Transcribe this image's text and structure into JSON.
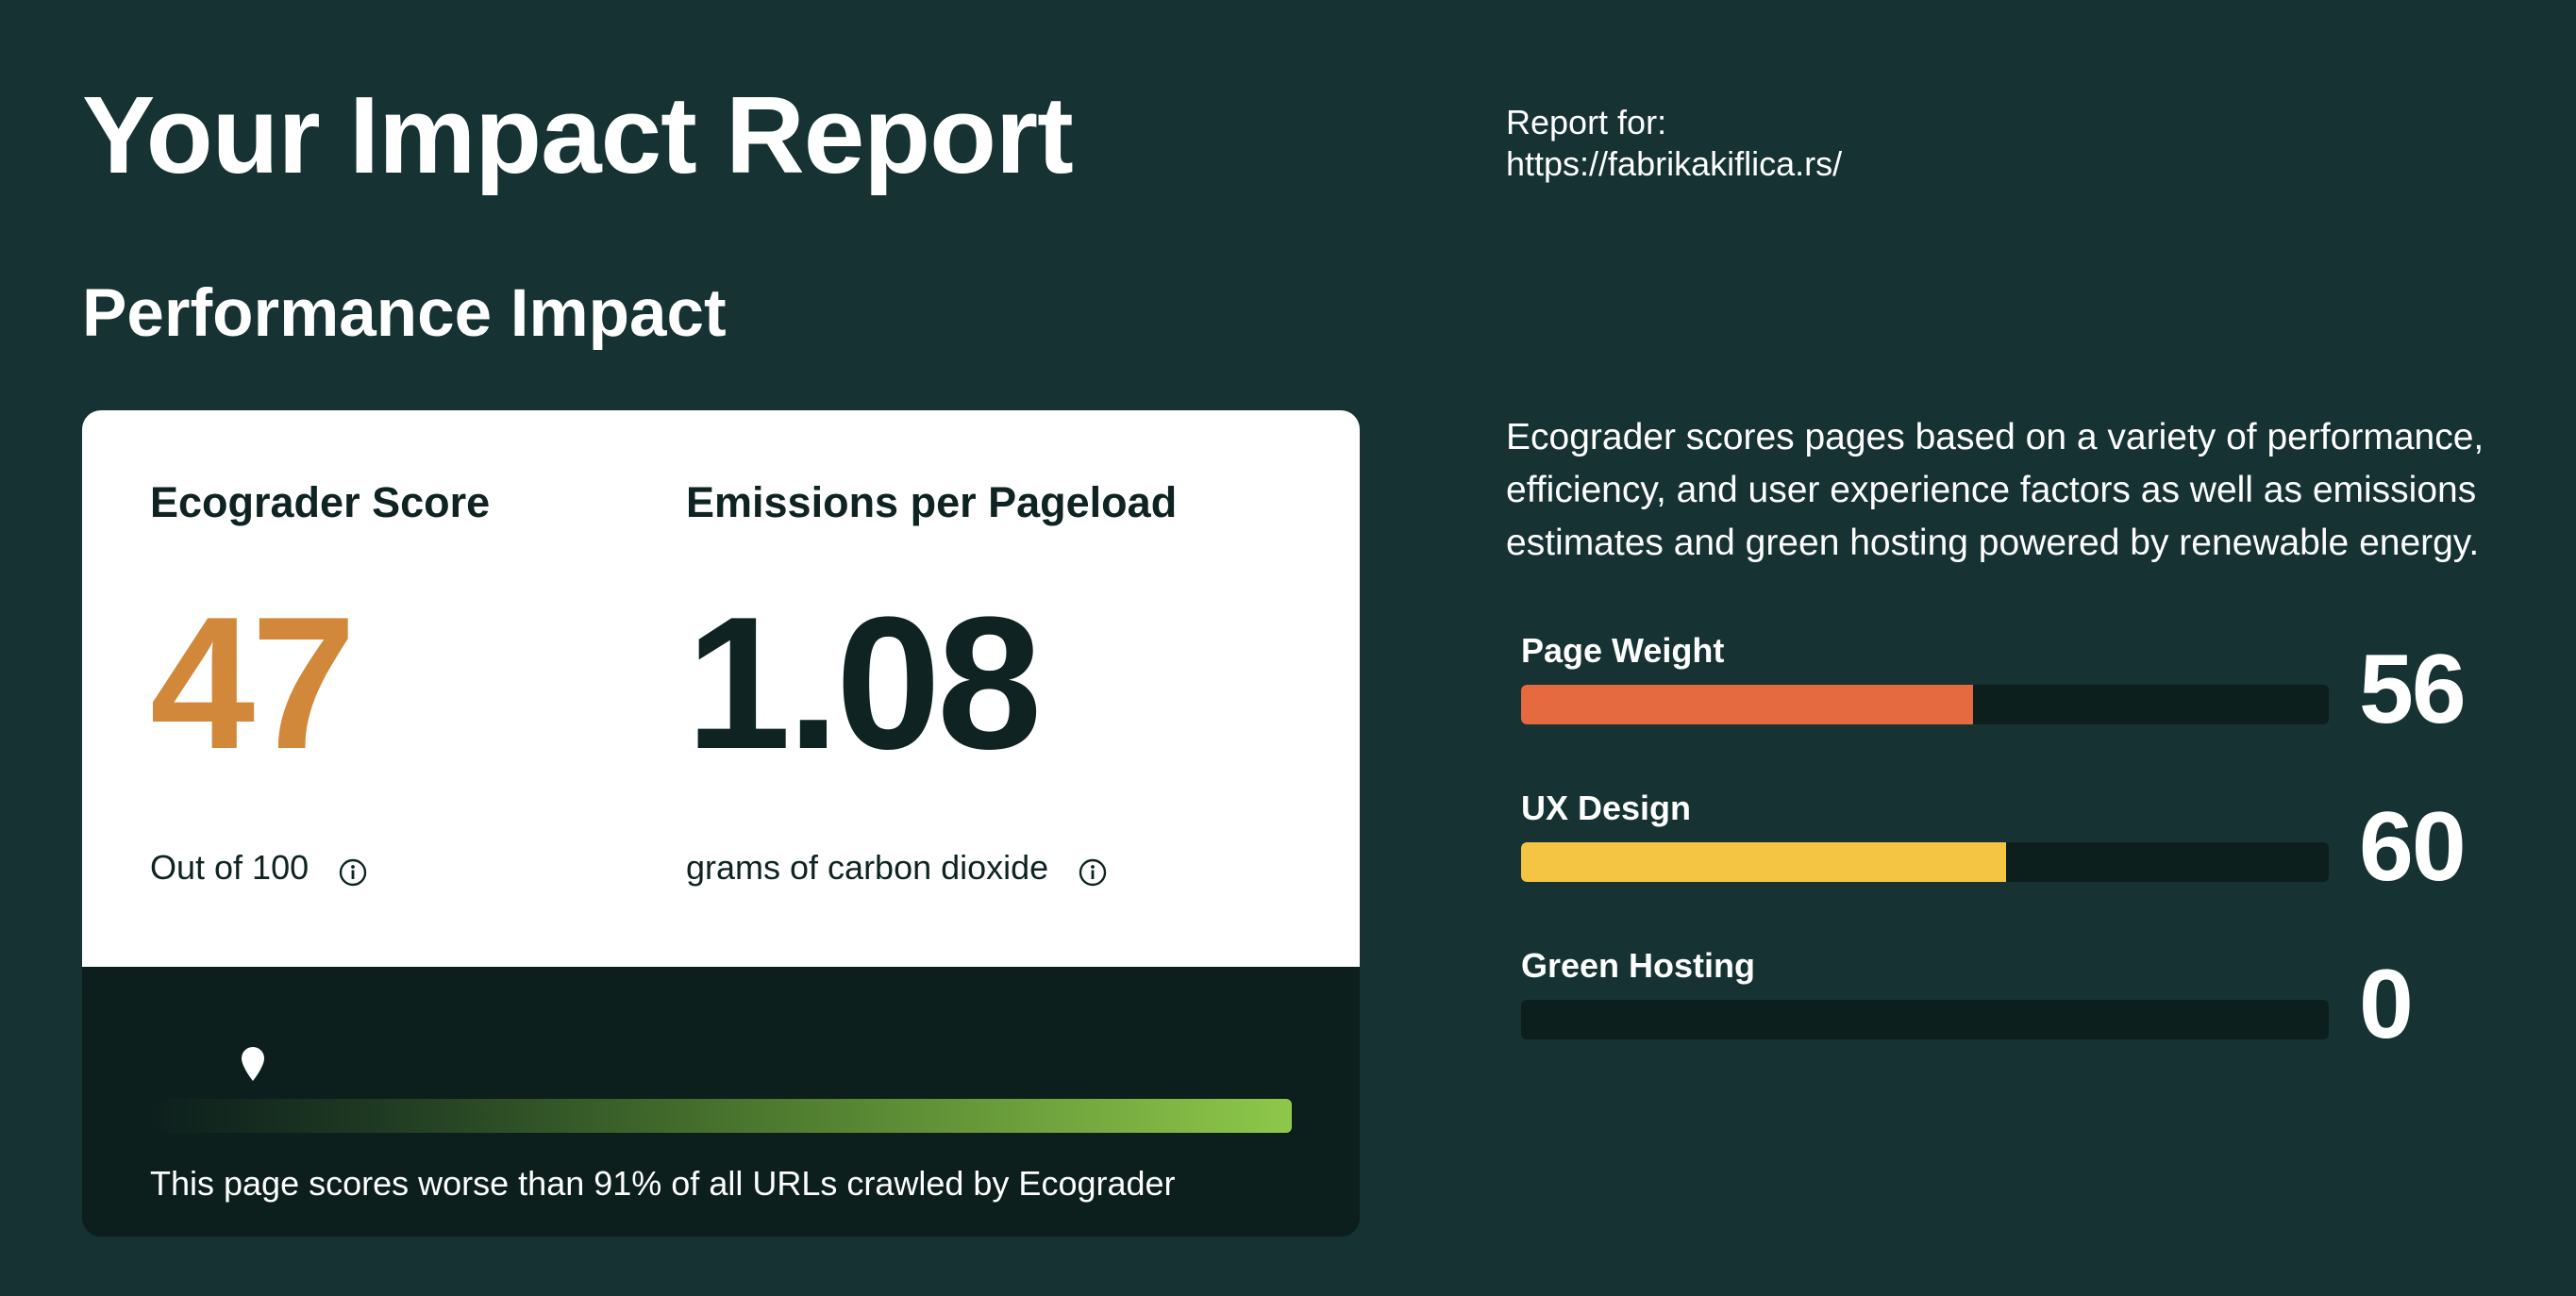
{
  "header": {
    "title": "Your Impact Report",
    "report_for_label": "Report for:",
    "report_url": "https://fabrikakiflica.rs/"
  },
  "section_title": "Performance Impact",
  "score_card": {
    "score": {
      "label": "Ecograder Score",
      "value": "47",
      "caption": "Out of 100",
      "icon": "info-icon",
      "color": "#d2883a"
    },
    "emissions": {
      "label": "Emissions per Pageload",
      "value": "1.08",
      "caption": "grams of carbon dioxide",
      "icon": "info-icon"
    },
    "percentile": {
      "text": "This page scores worse than 91% of all URLs crawled by Ecograder",
      "marker_position": 0.09,
      "marker_icon": "location-pin-icon"
    }
  },
  "description": "Ecograder scores pages based on a variety of performance, efficiency, and user experience factors as well as emissions estimates and green hosting powered by renewable energy.",
  "factors": [
    {
      "label": "Page Weight",
      "value": "56",
      "score": 56,
      "color": "#e56a40"
    },
    {
      "label": "UX Design",
      "value": "60",
      "score": 60,
      "color": "#f4c542"
    },
    {
      "label": "Green Hosting",
      "value": "0",
      "score": 0,
      "color": "#4caf50"
    }
  ]
}
